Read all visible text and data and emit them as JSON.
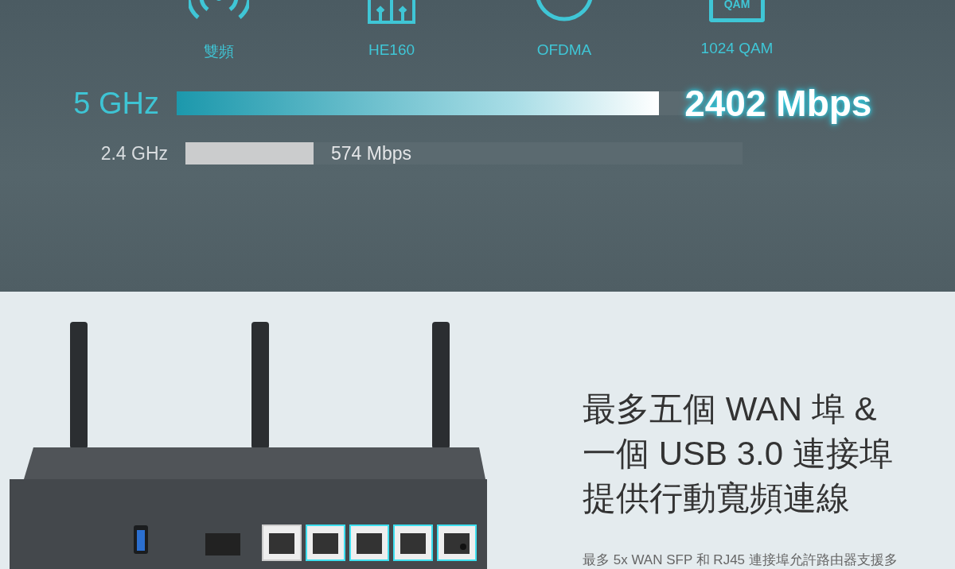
{
  "features": [
    {
      "kind": "wifi",
      "label": "雙頻"
    },
    {
      "kind": "bars",
      "label": "HE160"
    },
    {
      "kind": "circle",
      "label": "OFDMA"
    },
    {
      "kind": "qam",
      "icon_text": "QAM",
      "label": "1024 QAM"
    }
  ],
  "speeds": [
    {
      "kind": "primary",
      "band": "5 GHz",
      "level": 0.866,
      "reading": "2402 Mbps"
    },
    {
      "kind": "secondary",
      "band": "2.4 GHz",
      "level": 0.23,
      "reading": "574 Mbps"
    }
  ],
  "product": {
    "heading_lines": [
      "最多五個 WAN 埠 &",
      "一個 USB 3.0 連接埠",
      "提供行動寬頻連線"
    ],
    "body": "最多 5x WAN SFP 和 RJ45 連接埠允許路由器支援多"
  }
}
